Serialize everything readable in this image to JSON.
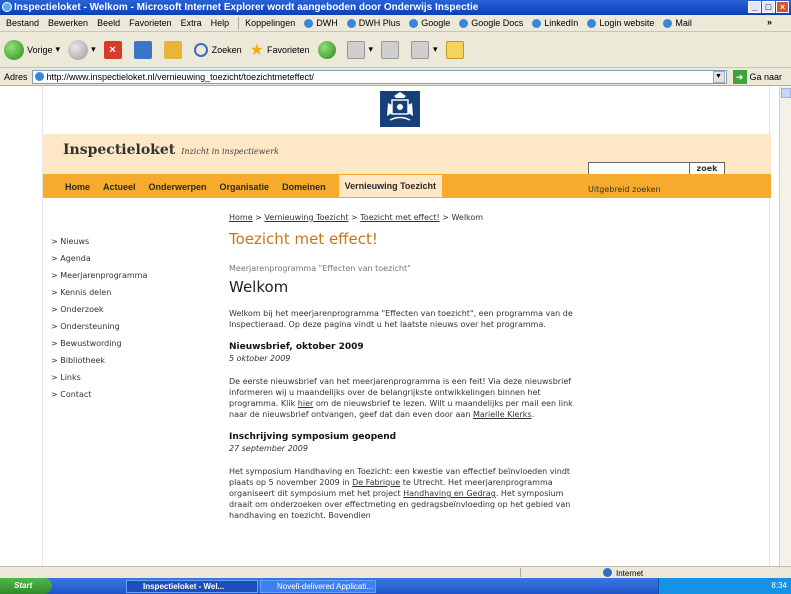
{
  "window": {
    "title": "Inspectieloket - Welkom - Microsoft Internet Explorer wordt aangeboden door Onderwijs Inspectie",
    "min_glyph": "_",
    "max_glyph": "□",
    "close_glyph": "×"
  },
  "menubar": {
    "items": [
      "Bestand",
      "Bewerken",
      "Beeld",
      "Favorieten",
      "Extra",
      "Help"
    ],
    "links_label": "Koppelingen",
    "links": [
      "DWH",
      "DWH Plus",
      "Google",
      "Google Docs",
      "LinkedIn",
      "Login website",
      "Mail"
    ],
    "chevron": "»"
  },
  "toolbar": {
    "back": "Vorige",
    "search": "Zoeken",
    "favorites": "Favorieten"
  },
  "address": {
    "label": "Adres",
    "url": "http://www.inspectieloket.nl/vernieuwing_toezicht/toezichtmeteffect/",
    "go": "Ga naar"
  },
  "site": {
    "brand": "Inspectieloket",
    "tagline": "Inzicht in inspectiewerk",
    "nav": [
      "Home",
      "Actueel",
      "Onderwerpen",
      "Organisatie",
      "Domeinen",
      "Vernieuwing Toezicht"
    ],
    "search_button": "zoek",
    "advanced_search": "Uitgebreid zoeken",
    "sidebar": [
      "Nieuws",
      "Agenda",
      "Meerjarenprogramma",
      "Kennis delen",
      "Onderzoek",
      "Ondersteuning",
      "Bewustwording",
      "Bibliotheek",
      "Links",
      "Contact"
    ]
  },
  "main": {
    "breadcrumb": {
      "home": "Home",
      "section": "Vernieuwing Toezicht",
      "parent": "Toezicht met effect!",
      "current": "Welkom"
    },
    "title": "Toezicht met effect!",
    "subtitle": "Meerjarenprogramma \"Effecten van toezicht\"",
    "heading": "Welkom",
    "intro": "Welkom bij het meerjarenprogramma \"Effecten van toezicht\", een programma van de Inspectieraad. Op deze pagina vindt u het laatste nieuws over het programma.",
    "news1": {
      "title": "Nieuwsbrief, oktober 2009",
      "date": "5 oktober 2009",
      "p1": "De eerste nieuwsbrief van het meerjarenprogramma is een feit! Via deze nieuwsbrief informeren wij u maandelijks over de belangrijkste ontwikkelingen binnen het programma. Klik ",
      "link1": "hier",
      "p2": " om de nieuwsbrief te lezen. Wilt u maandelijks per mail een link naar de nieuwsbrief ontvangen, geef dat dan even door aan ",
      "link2": "Marielle Klerks",
      "p3": "."
    },
    "news2": {
      "title": "Inschrijving symposium geopend",
      "date": "27 september 2009",
      "p1": "Het symposium Handhaving en Toezicht: een kwestie van effectief beïnvloeden vindt plaats op 5 november 2009 in ",
      "link1": "De Fabrique",
      "p2": " te Utrecht. Het meerjarenprogramma organiseert dit symposium met het project ",
      "link2": "Handhaving en Gedrag",
      "p3": ". Het symposium draait om onderzoeken over effectmeting en gedragsbeïnvloeding op het gebied van handhaving en toezicht. Bovendien"
    }
  },
  "status": {
    "zone": "Internet"
  },
  "taskbar": {
    "start": "Start",
    "tasks": [
      "Inspectieloket - Wel...",
      "Novell-delivered Applicati..."
    ],
    "clock": "8:34"
  }
}
